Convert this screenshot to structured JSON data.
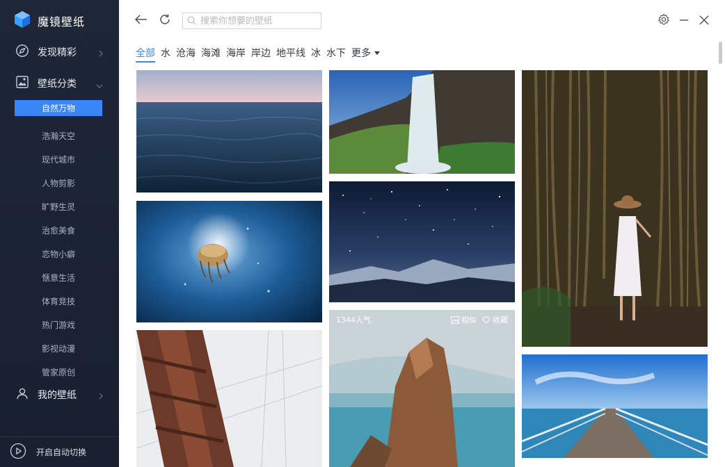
{
  "app": {
    "brand": "魔镜壁纸"
  },
  "sidebar": {
    "discover_label": "发现精彩",
    "category_label": "壁纸分类",
    "mine_label": "我的壁纸",
    "auto_switch_label": "开启自动切换",
    "categories": [
      "自然万物",
      "浩瀚天空",
      "现代城市",
      "人物剪影",
      "旷野生灵",
      "治愈美食",
      "恋物小癖",
      "惬意生活",
      "体育竞技",
      "热门游戏",
      "影视动漫",
      "管家原创"
    ],
    "active_category": "自然万物"
  },
  "search": {
    "placeholder": "搜索你想要的壁纸",
    "value": ""
  },
  "tabs": [
    "全部",
    "水",
    "沧海",
    "海滩",
    "海岸",
    "岸边",
    "地平线",
    "冰",
    "水下"
  ],
  "tabs_active": "全部",
  "tabs_more": "更多",
  "wallpapers": {
    "hovered": {
      "popularity": "1344人气",
      "similar_label": "相似",
      "favorite_label": "收藏"
    }
  },
  "colors": {
    "accent": "#3b86f7",
    "sidebar_bg": "#1f2637"
  }
}
